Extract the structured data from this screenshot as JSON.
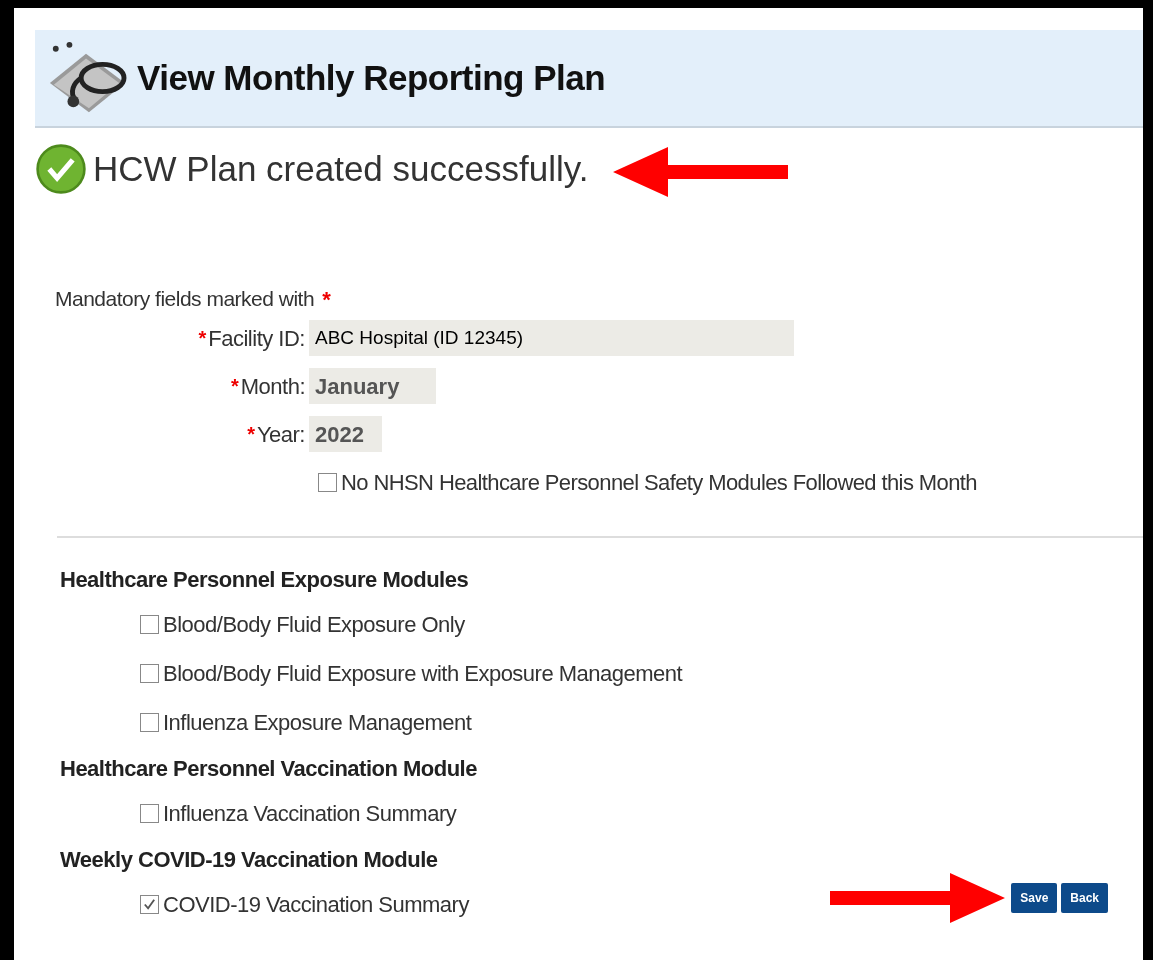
{
  "header": {
    "title": "View Monthly Reporting Plan"
  },
  "message": "HCW Plan created successfully.",
  "mandatory_note": {
    "text": "Mandatory fields marked with",
    "marker": "*"
  },
  "fields": [
    {
      "label": "Facility ID:",
      "marker": "*",
      "value": "ABC Hospital (ID 12345)"
    },
    {
      "label": "Month:",
      "marker": "*",
      "value": "January"
    },
    {
      "label": "Year:",
      "marker": "*",
      "value": "2022"
    }
  ],
  "no_modules": {
    "label": "No NHSN Healthcare Personnel Safety Modules Followed this Month",
    "checked": false
  },
  "sections": [
    {
      "title": "Healthcare Personnel Exposure Modules",
      "items": [
        {
          "label": "Blood/Body Fluid Exposure Only",
          "checked": false
        },
        {
          "label": "Blood/Body Fluid Exposure with Exposure Management",
          "checked": false
        },
        {
          "label": "Influenza Exposure Management",
          "checked": false
        }
      ]
    },
    {
      "title": "Healthcare Personnel Vaccination Module",
      "items": [
        {
          "label": "Influenza Vaccination Summary",
          "checked": false
        }
      ]
    },
    {
      "title": "Weekly COVID-19 Vaccination Module",
      "items": [
        {
          "label": "COVID-19 Vaccination Summary",
          "checked": true
        }
      ]
    }
  ],
  "buttons": [
    "Save",
    "Back"
  ]
}
